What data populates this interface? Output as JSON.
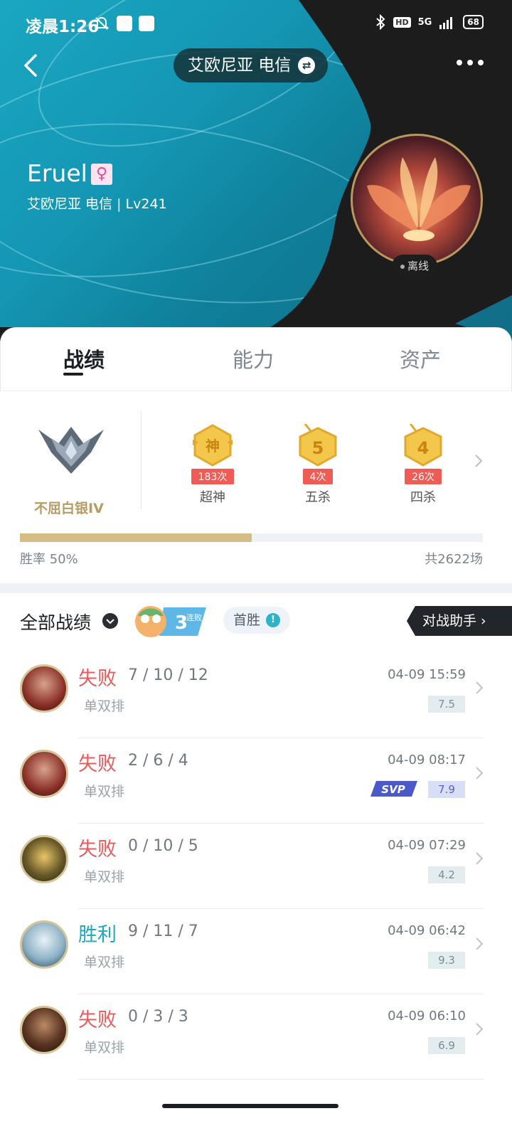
{
  "status_bar": {
    "time": "凌晨1:26",
    "hd": "HD",
    "network": "5G",
    "battery": "68"
  },
  "header": {
    "server_label": "艾欧尼亚 电信",
    "player_name": "Eruel",
    "player_sub": "艾欧尼亚 电信 | Lv241",
    "online_status": "离线"
  },
  "tabs": [
    {
      "label": "战绩",
      "active": true
    },
    {
      "label": "能力",
      "active": false
    },
    {
      "label": "资产",
      "active": false
    }
  ],
  "rank": {
    "name": "不屈白银IV"
  },
  "achievements": [
    {
      "glyph": "神",
      "count": "183次",
      "label": "超神"
    },
    {
      "glyph": "5",
      "count": "4次",
      "label": "五杀"
    },
    {
      "glyph": "4",
      "count": "26次",
      "label": "四杀"
    }
  ],
  "stats": {
    "winrate_label": "胜率  50%",
    "winrate_value": 0.5,
    "total_games": "共2622场"
  },
  "filter": {
    "title": "全部战绩",
    "streak_number": "3",
    "streak_text": "连败",
    "first_win": "首胜",
    "assistant": "对战助手"
  },
  "matches": [
    {
      "result": "失败",
      "outcome": "lose",
      "kda": "7 / 10 / 12",
      "mode": "单双排",
      "time": "04-09 15:59",
      "score": "7.5",
      "svp": false,
      "champion_icon": "champion-portrait-red-hair"
    },
    {
      "result": "失败",
      "outcome": "lose",
      "kda": "2 / 6 / 4",
      "mode": "单双排",
      "time": "04-09 08:17",
      "score": "7.9",
      "svp": true,
      "svp_label": "SVP",
      "champion_icon": "champion-portrait-red-hair"
    },
    {
      "result": "失败",
      "outcome": "lose",
      "kda": "0 / 10 / 5",
      "mode": "单双排",
      "time": "04-09 07:29",
      "score": "4.2",
      "svp": false,
      "champion_icon": "champion-portrait-armored-mech"
    },
    {
      "result": "胜利",
      "outcome": "win",
      "kda": "9 / 11 / 7",
      "mode": "单双排",
      "time": "04-09 06:42",
      "score": "9.3",
      "svp": false,
      "champion_icon": "champion-portrait-white-hair"
    },
    {
      "result": "失败",
      "outcome": "lose",
      "kda": "0 / 3 / 3",
      "mode": "单双排",
      "time": "04-09 06:10",
      "score": "6.9",
      "svp": false,
      "champion_icon": "champion-portrait-bearded"
    }
  ],
  "colors": {
    "lose": "#ea5a5a",
    "win": "#1aa9c0",
    "rank_gold": "#b69b66",
    "progress": "#d6bd85"
  }
}
